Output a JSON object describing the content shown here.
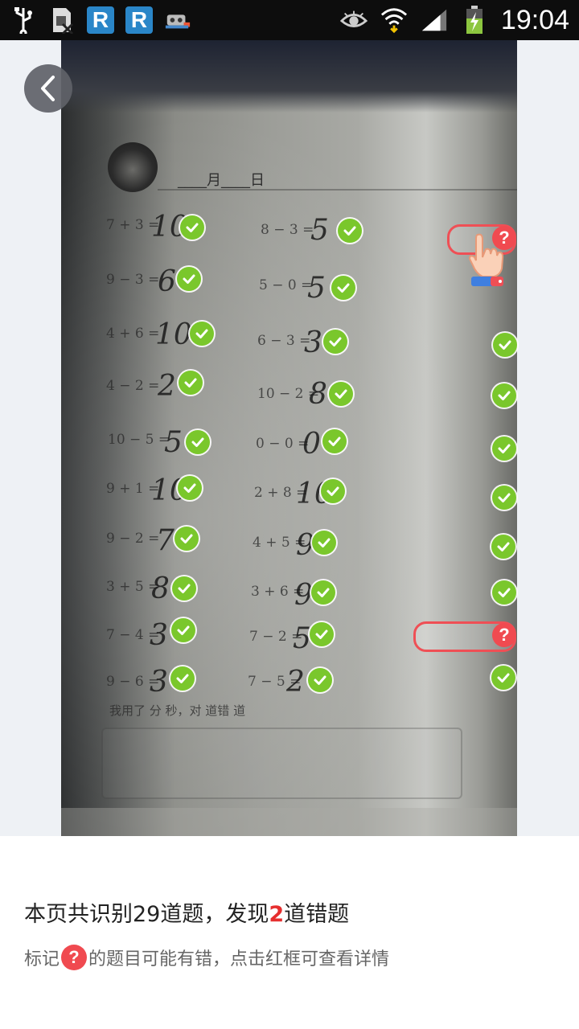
{
  "status_bar": {
    "time": "19:04",
    "left_icons": [
      "usb-icon",
      "sim-blocked-icon",
      "r-app-icon",
      "r-app-icon",
      "robot-app-icon"
    ],
    "right_icons": [
      "eye-icon",
      "wifi-icon",
      "signal-icon",
      "battery-charging-icon"
    ],
    "app_letter": "R"
  },
  "worksheet": {
    "header": "____月____日",
    "problems_col1": [
      {
        "eq": "7 + 3 =",
        "ans": "10"
      },
      {
        "eq": "9 − 3 =",
        "ans": "6"
      },
      {
        "eq": "4 + 6 =",
        "ans": "10"
      },
      {
        "eq": "4 − 2 =",
        "ans": "2"
      },
      {
        "eq": "10 − 5 =",
        "ans": "5"
      },
      {
        "eq": "9 + 1 =",
        "ans": "10"
      },
      {
        "eq": "9 − 2 =",
        "ans": "7"
      },
      {
        "eq": "3 + 5 =",
        "ans": "8"
      },
      {
        "eq": "7 − 4 =",
        "ans": "3"
      },
      {
        "eq": "9 − 6 =",
        "ans": "3"
      }
    ],
    "problems_col2": [
      {
        "eq": "8 − 3 =",
        "ans": "5"
      },
      {
        "eq": "5 − 0 =",
        "ans": "5"
      },
      {
        "eq": "6 − 3 =",
        "ans": "3"
      },
      {
        "eq": "10 − 2 =",
        "ans": "8"
      },
      {
        "eq": "0 − 0 =",
        "ans": "0"
      },
      {
        "eq": "2 + 8 =",
        "ans": "10"
      },
      {
        "eq": "4 + 5 =",
        "ans": "9"
      },
      {
        "eq": "3 + 6 =",
        "ans": "9"
      },
      {
        "eq": "7 − 2 =",
        "ans": "5"
      },
      {
        "eq": "7 − 5 =",
        "ans": "2"
      }
    ],
    "footer": "我用了    分      秒，对      道错      道"
  },
  "colors": {
    "check_green": "#7ac72c",
    "error_red": "#f04a50",
    "highlight_red": "#e62e2e"
  },
  "result": {
    "summary_prefix": "本页共识别29道题，发现",
    "error_count": "2",
    "summary_suffix": "道错题",
    "hint_prefix": "标记",
    "hint_mark": "?",
    "hint_suffix": "的题目可能有错，点击红框可查看详情"
  },
  "marks": {
    "error_symbol": "?"
  }
}
